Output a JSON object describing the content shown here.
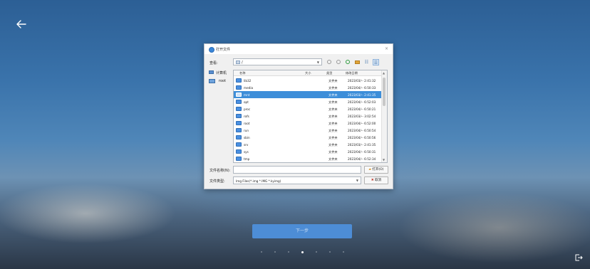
{
  "dialog": {
    "title": "打开文件",
    "close": "×",
    "look_in_label": "查看:",
    "path": "/",
    "sidebar": [
      {
        "label": "计算机"
      },
      {
        "label": "root"
      }
    ],
    "columns": {
      "name": "名称",
      "size": "大小",
      "type": "类型",
      "date": "修改日期"
    },
    "files": [
      {
        "name": "lib32",
        "type": "文件夹",
        "date": "2023/03/-- 2:41:32",
        "selected": false
      },
      {
        "name": "media",
        "type": "文件夹",
        "date": "2023/04/-- 6:50:33",
        "selected": false
      },
      {
        "name": "mnt",
        "type": "文件夹",
        "date": "2023/03/-- 2:41:35",
        "selected": true
      },
      {
        "name": "opt",
        "type": "文件夹",
        "date": "2023/04/-- 6:52:03",
        "selected": false
      },
      {
        "name": "proc",
        "type": "文件夹",
        "date": "2023/04/-- 6:50:21",
        "selected": false
      },
      {
        "name": "rofs",
        "type": "文件夹",
        "date": "2023/03/-- 3:02:54",
        "selected": false
      },
      {
        "name": "root",
        "type": "文件夹",
        "date": "2023/04/-- 6:52:00",
        "selected": false
      },
      {
        "name": "run",
        "type": "文件夹",
        "date": "2023/04/-- 6:50:54",
        "selected": false
      },
      {
        "name": "sbin",
        "type": "文件夹",
        "date": "2023/04/-- 6:50:56",
        "selected": false
      },
      {
        "name": "srv",
        "type": "文件夹",
        "date": "2023/03/-- 2:41:35",
        "selected": false
      },
      {
        "name": "sys",
        "type": "文件夹",
        "date": "2023/04/-- 6:50:31",
        "selected": false
      },
      {
        "name": "tmp",
        "type": "文件夹",
        "date": "2023/04/-- 6:52:34",
        "selected": false
      }
    ],
    "filename_label": "文件名称(N):",
    "filename_value": "",
    "filetype_label": "文件类型:",
    "filetype_value": "Img Files(*.img *.IMG *.kyimg)",
    "open_button": "打开(O)",
    "cancel_button": "取消"
  },
  "next_button": "下一步",
  "pagination": {
    "total": 7,
    "active": 3
  },
  "colors": {
    "accent": "#3d8ed9",
    "next_button": "#4d8dd6"
  }
}
